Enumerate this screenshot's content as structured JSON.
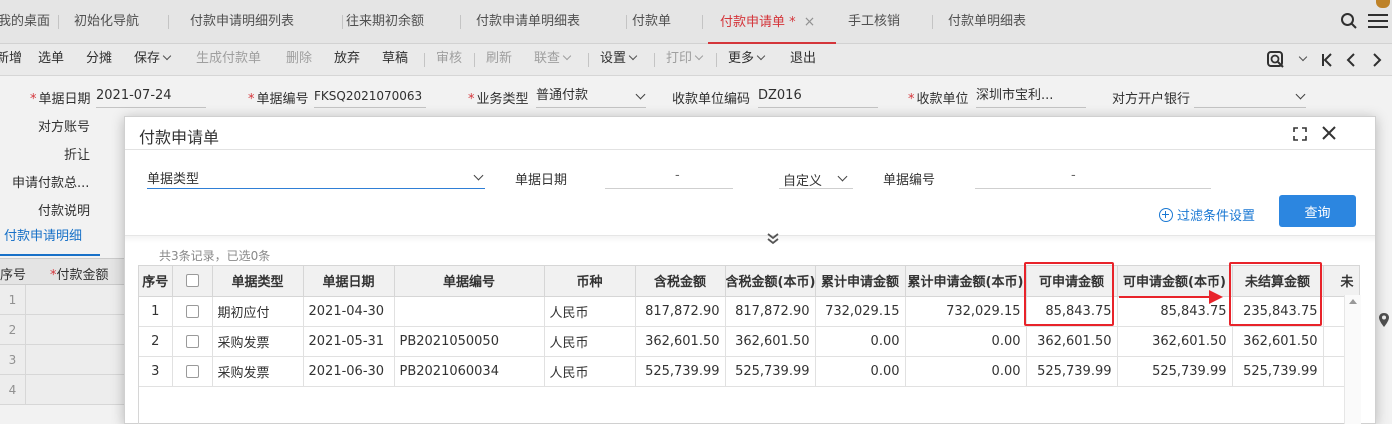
{
  "tabs": [
    {
      "label": "我的桌面",
      "active": false
    },
    {
      "label": "初始化导航",
      "active": false
    },
    {
      "label": "付款申请明细列表",
      "active": false
    },
    {
      "label": "往来期初余额",
      "active": false
    },
    {
      "label": "付款申请单明细表",
      "active": false
    },
    {
      "label": "付款单",
      "active": false
    },
    {
      "label": "付款申请单 *",
      "active": true,
      "close": "×"
    },
    {
      "label": "手工核销",
      "active": false
    },
    {
      "label": "付款单明细表",
      "active": false
    }
  ],
  "toolbar": {
    "new": "新增",
    "select": "选单",
    "split": "分摊",
    "save": "保存",
    "generate_payment": "生成付款单",
    "delete": "删除",
    "abandon": "放弃",
    "draft": "草稿",
    "audit": "审核",
    "refresh": "刷新",
    "link_query": "联查",
    "settings": "设置",
    "print": "打印",
    "more": "更多",
    "exit": "退出"
  },
  "form": {
    "doc_date_label": "单据日期",
    "doc_date_value": "2021-07-24",
    "doc_no_label": "单据编号",
    "doc_no_value": "FKSQ2021070063",
    "biz_type_label": "业务类型",
    "biz_type_value": "普通付款",
    "payee_code_label": "收款单位编码",
    "payee_code_value": "DZ016",
    "payee_label": "收款单位",
    "payee_value": "深圳市宝利...",
    "bank_label": "对方开户银行",
    "account_label": "对方账号",
    "discount_label": "折让",
    "apply_total_label": "申请付款总...",
    "remark_label": "付款说明",
    "detail_tab": "付款申请明细",
    "mini_grid": {
      "seq": "序号",
      "amount": "付款金额",
      "rows": [
        "1",
        "2",
        "3",
        "4"
      ]
    }
  },
  "dialog": {
    "title": "付款申请单",
    "doc_type_label": "单据类型",
    "doc_date_label": "单据日期",
    "date_from": "-",
    "date_mode": "自定义",
    "doc_no_label": "单据编号",
    "doc_no_dash": "-",
    "filter_link": "过滤条件设置",
    "query_button": "查询",
    "record_count": "共3条记录，已选0条",
    "grid": {
      "headers": [
        "序号",
        "",
        "单据类型",
        "单据日期",
        "单据编号",
        "币种",
        "含税金额",
        "含税金额(本币)",
        "累计申请金额",
        "累计申请金额(本币)",
        "可申请金额",
        "可申请金额(本币)",
        "未结算金额",
        "未"
      ],
      "rows": [
        [
          "1",
          "",
          "期初应付",
          "2021-04-30",
          "",
          "人民币",
          "817,872.90",
          "817,872.90",
          "732,029.15",
          "732,029.15",
          "85,843.75",
          "85,843.75",
          "235,843.75",
          ""
        ],
        [
          "2",
          "",
          "采购发票",
          "2021-05-31",
          "PB2021050050",
          "人民币",
          "362,601.50",
          "362,601.50",
          "0.00",
          "0.00",
          "362,601.50",
          "362,601.50",
          "362,601.50",
          ""
        ],
        [
          "3",
          "",
          "采购发票",
          "2021-06-30",
          "PB2021060034",
          "人民币",
          "525,739.99",
          "525,739.99",
          "0.00",
          "0.00",
          "525,739.99",
          "525,739.99",
          "525,739.99",
          ""
        ]
      ]
    }
  },
  "icons": {
    "search": "search-icon",
    "menu": "menu-icon",
    "close": "close-icon",
    "maximize": "maximize-icon",
    "collapse": "double-chevron-down-icon",
    "filter": "add-circle-icon",
    "location": "location-pin-icon"
  },
  "colors": {
    "active_tab": "#e0383e",
    "link_blue": "#1a78d3",
    "query_button": "#2c86e0",
    "annotation_red": "#e8232a"
  }
}
